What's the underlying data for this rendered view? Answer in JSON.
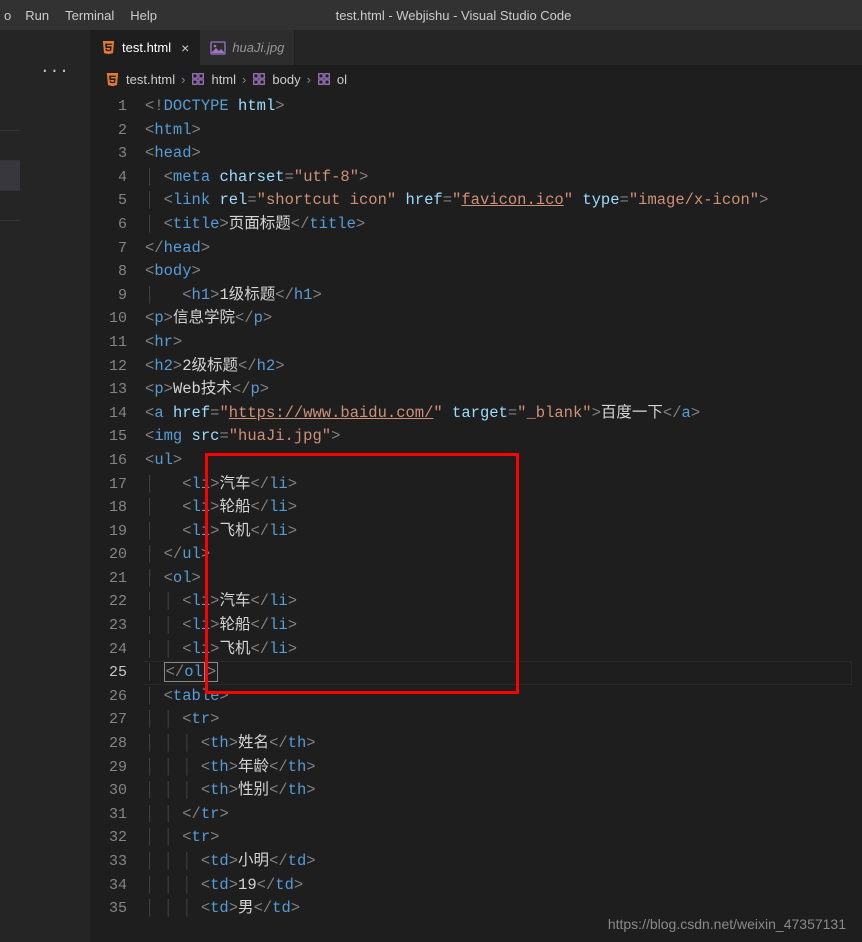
{
  "window": {
    "title": "test.html - Webjishu - Visual Studio Code"
  },
  "menu": {
    "go": "o",
    "run": "Run",
    "terminal": "Terminal",
    "help": "Help"
  },
  "tabs": {
    "active": {
      "name": "test.html"
    },
    "other": {
      "name": "huaJi.jpg"
    }
  },
  "breadcrumbs": {
    "file": "test.html",
    "p1": "html",
    "p2": "body",
    "p3": "ol"
  },
  "ln": {
    "1": "1",
    "2": "2",
    "3": "3",
    "4": "4",
    "5": "5",
    "6": "6",
    "7": "7",
    "8": "8",
    "9": "9",
    "10": "10",
    "11": "11",
    "12": "12",
    "13": "13",
    "14": "14",
    "15": "15",
    "16": "16",
    "17": "17",
    "18": "18",
    "19": "19",
    "20": "20",
    "21": "21",
    "22": "22",
    "23": "23",
    "24": "24",
    "25": "25",
    "26": "26",
    "27": "27",
    "28": "28",
    "29": "29",
    "30": "30",
    "31": "31",
    "32": "32",
    "33": "33",
    "34": "34",
    "35": "35"
  },
  "code": {
    "l1": {
      "a": "<!",
      "b": "DOCTYPE",
      "sp": " ",
      "c": "html",
      "d": ">"
    },
    "l2": {
      "a": "<",
      "b": "html",
      "c": ">"
    },
    "l3": {
      "a": "<",
      "b": "head",
      "c": ">"
    },
    "l4": {
      "a": "<",
      "b": "meta",
      "sp": " ",
      "c": "charset",
      "d": "=",
      "e": "\"utf-8\"",
      "f": ">"
    },
    "l5": {
      "a": "<",
      "b": "link",
      "s1": " ",
      "c": "rel",
      "d": "=",
      "e": "\"shortcut icon\"",
      "s2": " ",
      "f": "href",
      "g": "=",
      "h1": "\"",
      "h2": "favicon.ico",
      "h3": "\"",
      "s3": " ",
      "i": "type",
      "j": "=",
      "k": "\"image/x-icon\"",
      "l": ">"
    },
    "l6": {
      "a": "<",
      "b": "title",
      "c": ">",
      "d": "页面标题",
      "e": "</",
      "f": "title",
      "g": ">"
    },
    "l7": {
      "a": "</",
      "b": "head",
      "c": ">"
    },
    "l8": {
      "a": "<",
      "b": "body",
      "c": ">"
    },
    "l9": {
      "a": "<",
      "b": "h1",
      "c": ">",
      "d": "1级标题",
      "e": "</",
      "f": "h1",
      "g": ">"
    },
    "l10": {
      "a": "<",
      "b": "p",
      "c": ">",
      "d": "信息学院",
      "e": "</",
      "f": "p",
      "g": ">"
    },
    "l11": {
      "a": "<",
      "b": "hr",
      "c": ">"
    },
    "l12": {
      "a": "<",
      "b": "h2",
      "c": ">",
      "d": "2级标题",
      "e": "</",
      "f": "h2",
      "g": ">"
    },
    "l13": {
      "a": "<",
      "b": "p",
      "c": ">",
      "d": "Web技术",
      "e": "</",
      "f": "p",
      "g": ">"
    },
    "l14": {
      "a": "<",
      "b": "a",
      "s1": " ",
      "c": "href",
      "d": "=",
      "e1": "\"",
      "e2": "https://www.baidu.com/",
      "e3": "\"",
      "s2": " ",
      "f": "target",
      "g": "=",
      "h": "\"_blank\"",
      "i": ">",
      "j": "百度一下",
      "k": "</",
      "l": "a",
      "m": ">"
    },
    "l15": {
      "a": "<",
      "b": "img",
      "s1": " ",
      "c": "src",
      "d": "=",
      "e": "\"huaJi.jpg\"",
      "f": ">"
    },
    "l16": {
      "a": "<",
      "b": "ul",
      "c": ">"
    },
    "l17": {
      "a": "<",
      "b": "li",
      "c": ">",
      "d": "汽车",
      "e": "</",
      "f": "li",
      "g": ">"
    },
    "l18": {
      "a": "<",
      "b": "li",
      "c": ">",
      "d": "轮船",
      "e": "</",
      "f": "li",
      "g": ">"
    },
    "l19": {
      "a": "<",
      "b": "li",
      "c": ">",
      "d": "飞机",
      "e": "</",
      "f": "li",
      "g": ">"
    },
    "l20": {
      "a": "</",
      "b": "ul",
      "c": ">"
    },
    "l21": {
      "a": "<",
      "b": "ol",
      "c": ">"
    },
    "l22": {
      "a": "<",
      "b": "li",
      "c": ">",
      "d": "汽车",
      "e": "</",
      "f": "li",
      "g": ">"
    },
    "l23": {
      "a": "<",
      "b": "li",
      "c": ">",
      "d": "轮船",
      "e": "</",
      "f": "li",
      "g": ">"
    },
    "l24": {
      "a": "<",
      "b": "li",
      "c": ">",
      "d": "飞机",
      "e": "</",
      "f": "li",
      "g": ">"
    },
    "l25": {
      "a": "</",
      "b": "ol",
      "c": ">"
    },
    "l26": {
      "a": "<",
      "b": "table",
      "c": ">"
    },
    "l27": {
      "a": "<",
      "b": "tr",
      "c": ">"
    },
    "l28": {
      "a": "<",
      "b": "th",
      "c": ">",
      "d": "姓名",
      "e": "</",
      "f": "th",
      "g": ">"
    },
    "l29": {
      "a": "<",
      "b": "th",
      "c": ">",
      "d": "年龄",
      "e": "</",
      "f": "th",
      "g": ">"
    },
    "l30": {
      "a": "<",
      "b": "th",
      "c": ">",
      "d": "性别",
      "e": "</",
      "f": "th",
      "g": ">"
    },
    "l31": {
      "a": "</",
      "b": "tr",
      "c": ">"
    },
    "l32": {
      "a": "<",
      "b": "tr",
      "c": ">"
    },
    "l33": {
      "a": "<",
      "b": "td",
      "c": ">",
      "d": "小明",
      "e": "</",
      "f": "td",
      "g": ">"
    },
    "l34": {
      "a": "<",
      "b": "td",
      "c": ">",
      "d": "19",
      "e": "</",
      "f": "td",
      "g": ">"
    },
    "l35": {
      "a": "<",
      "b": "td",
      "c": ">",
      "d": "男",
      "e": "</",
      "f": "td",
      "g": ">"
    }
  },
  "watermark": "https://blog.csdn.net/weixin_47357131"
}
